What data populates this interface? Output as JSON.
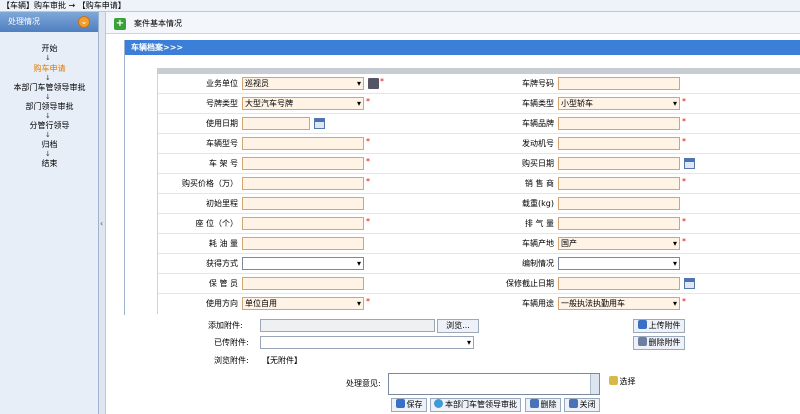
{
  "breadcrumb": "【车辆】购车审批 → 【购车申请】",
  "sidebar": {
    "title": "处理情况",
    "toggle": "⌄",
    "steps": [
      "开始",
      "购车申请",
      "本部门车管领导审批",
      "部门领导审批",
      "分管行领导",
      "归档",
      "结束"
    ],
    "active_step": "购车申请",
    "active_color": "#e07b00"
  },
  "tab": {
    "add": "+",
    "label": "案件基本情况"
  },
  "panel": {
    "title": "车辆档案>>>"
  },
  "form": {
    "org_label": "业务单位",
    "org_value": "巡视员",
    "plate_label": "车牌号码",
    "plate_value": "",
    "plate_type_label": "号牌类型",
    "plate_type_value": "大型汽车号牌",
    "car_type_label": "车辆类型",
    "car_type_value": "小型轿车",
    "use_date_label": "使用日期",
    "use_date_value": "",
    "brand_label": "车辆品牌",
    "brand_value": "",
    "model_label": "车辆型号",
    "model_value": "",
    "engine_label": "发动机号",
    "engine_value": "",
    "frame_label": "车 架 号",
    "frame_value": "",
    "buy_date_label": "购买日期",
    "buy_date_value": "",
    "price_label": "购买价格（万）",
    "price_value": "",
    "seller_label": "销 售 商",
    "seller_value": "",
    "mileage_label": "初始里程",
    "mileage_value": "",
    "load_label": "载重(kg)",
    "load_value": "",
    "seats_label": "座 位（个）",
    "seats_value": "",
    "displacement_label": "排 气 量",
    "displacement_value": "",
    "fuel_label": "耗 油 量",
    "fuel_value": "",
    "origin_label": "车辆产地",
    "origin_value": "国产",
    "acquire_label": "获得方式",
    "acquire_value": "",
    "staffing_label": "编制情况",
    "staffing_value": "",
    "keeper_label": "保 管 员",
    "keeper_value": "",
    "warranty_label": "保修截止日期",
    "warranty_value": "",
    "direction_label": "使用方向",
    "direction_value": "单位自用",
    "purpose_label": "车辆用途",
    "purpose_value": "一般执法执勤用车"
  },
  "attach": {
    "add_label": "添加附件:",
    "browse": "浏览...",
    "upload": "上传附件",
    "existing_label": "已传附件:",
    "existing_value": "",
    "delete_attach": "删除附件",
    "view_label": "浏览附件:",
    "view_value": "【无附件】",
    "opinion_label": "处理意见:",
    "select": "选择"
  },
  "actions": {
    "save": "保存",
    "submit": "本部门车管领导审批",
    "delete": "删除",
    "close": "关闭"
  },
  "colors": {
    "header_blue": "#3b7fd8",
    "required": "#ee0000",
    "field_bg": "#fff3e6"
  }
}
